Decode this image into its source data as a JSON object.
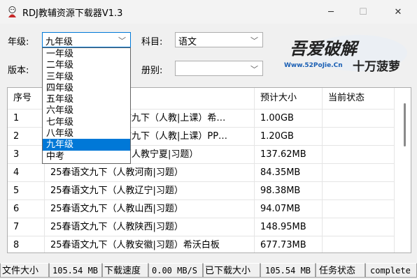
{
  "window": {
    "title": "RDJ教辅资源下载器V1.3",
    "min_glyph": "─",
    "max_glyph": "☐",
    "close_glyph": "✕"
  },
  "filters": {
    "grade_label": "年级:",
    "grade_value": "九年级",
    "subject_label": "科目:",
    "subject_value": "语文",
    "version_label": "版本:",
    "version_value": "",
    "volume_label": "册别:",
    "volume_value": ""
  },
  "grade_options": [
    "一年级",
    "二年级",
    "三年级",
    "四年级",
    "五年级",
    "六年级",
    "七年级",
    "八年级",
    "九年级",
    "中考"
  ],
  "grade_selected_index": 8,
  "logo": {
    "text": "吾爱破解",
    "url": "Www.52PoJie.Cn",
    "slogan": "十万菠萝"
  },
  "table": {
    "headers": {
      "no": "序号",
      "name": "",
      "size": "预计大小",
      "status": "当前状态"
    },
    "rows": [
      {
        "no": "1",
        "name": "文九下（人教|上课）希…",
        "size": "1.00GB",
        "status": ""
      },
      {
        "no": "2",
        "name": "文九下（人教|上课）PP…",
        "size": "1.20GB",
        "status": ""
      },
      {
        "no": "3",
        "name": "（人教宁夏|习题）",
        "size": "137.62MB",
        "status": ""
      },
      {
        "no": "4",
        "name": "25春语文九下（人教河南|习题）",
        "size": "84.35MB",
        "status": ""
      },
      {
        "no": "5",
        "name": "25春语文九下（人教辽宁|习题）",
        "size": "98.38MB",
        "status": ""
      },
      {
        "no": "6",
        "name": "25春语文九下（人教山西|习题）",
        "size": "94.07MB",
        "status": ""
      },
      {
        "no": "7",
        "name": "25春语文九下（人教陕西|习题）",
        "size": "148.95MB",
        "status": ""
      },
      {
        "no": "8",
        "name": "25春语文九下（人教安徽|习题）希沃白板",
        "size": "677.73MB",
        "status": ""
      }
    ]
  },
  "statusbar": {
    "file_size_label": "文件大小",
    "file_size_value": "105.54 MB",
    "speed_label": "下载速度",
    "speed_value": "0.00 MB/S",
    "downloaded_label": "已下载大小",
    "downloaded_value": "105.54 MB",
    "task_label": "任务状态",
    "task_value": "complete"
  },
  "colors": {
    "accent": "#0078d7",
    "logo_blue": "#1a5fb4",
    "logo_dark": "#222222"
  }
}
